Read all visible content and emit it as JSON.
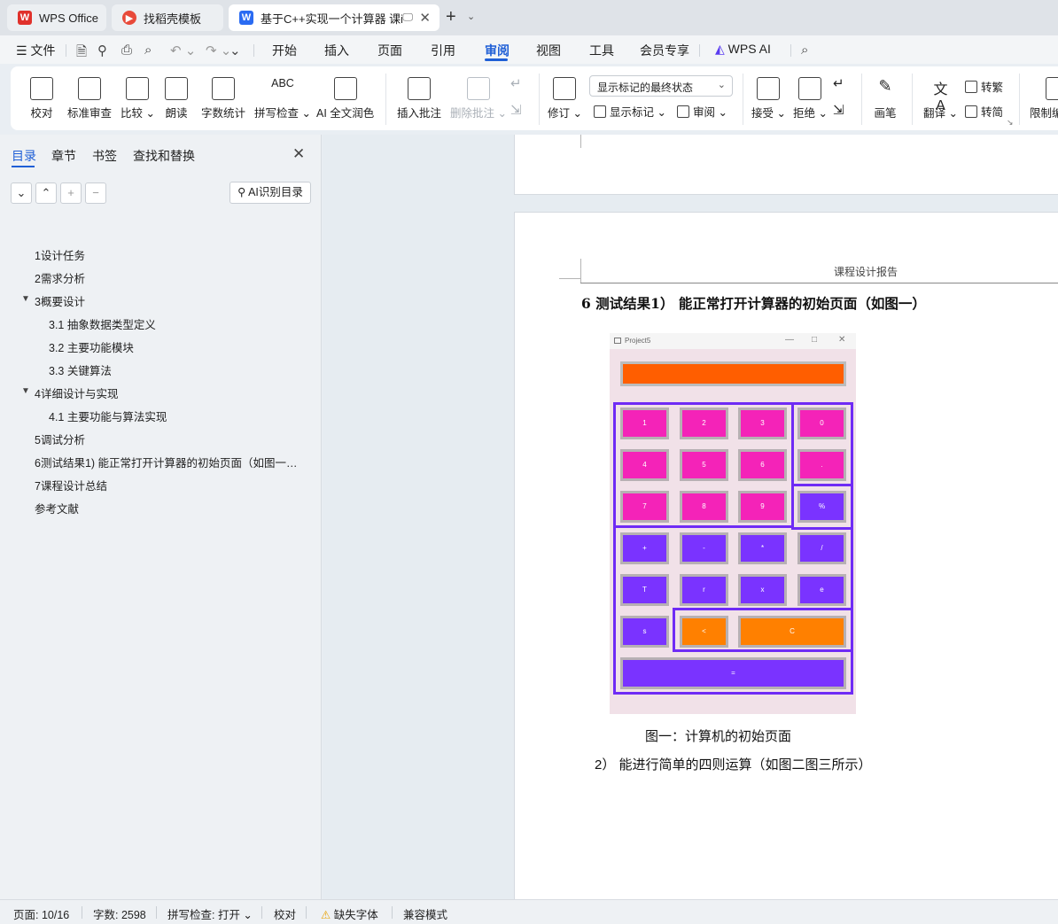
{
  "tabs": [
    {
      "label": "WPS Office",
      "logo": "W"
    },
    {
      "label": "找稻壳模板"
    },
    {
      "label": "基于C++实现一个计算器 课i",
      "logo": "W"
    }
  ],
  "menu": {
    "file": "文件",
    "items": [
      "开始",
      "插入",
      "页面",
      "引用",
      "审阅",
      "视图",
      "工具",
      "会员专享"
    ],
    "active": "审阅",
    "wps_ai": "WPS AI"
  },
  "ribbon": {
    "proofread": "校对",
    "std_review": "标准审查",
    "compare": "比较",
    "read_aloud": "朗读",
    "word_count": "字数统计",
    "spell_check": "拼写检查",
    "ai_polish": "AI 全文润色",
    "insert_comment": "插入批注",
    "delete_comment": "删除批注",
    "revise": "修订",
    "markup_state": "显示标记的最终状态",
    "show_markup": "显示标记",
    "review_pane": "审阅",
    "accept": "接受",
    "reject": "拒绝",
    "pen": "画笔",
    "translate": "翻译",
    "to_traditional": "转繁",
    "to_simplified": "转简",
    "restrict": "限制编"
  },
  "panel": {
    "tabs": [
      "目录",
      "章节",
      "书签",
      "查找和替换"
    ],
    "ai_toc": "AI识别目录",
    "toc": [
      {
        "text": "1设计任务",
        "level": 1
      },
      {
        "text": "2需求分析",
        "level": 1
      },
      {
        "text": "3概要设计",
        "level": 1,
        "expanded": true
      },
      {
        "text": "3.1 抽象数据类型定义",
        "level": 2
      },
      {
        "text": "3.2  主要功能模块",
        "level": 2
      },
      {
        "text": "3.3  关键算法",
        "level": 2
      },
      {
        "text": "4详细设计与实现",
        "level": 1,
        "expanded": true
      },
      {
        "text": "4.1  主要功能与算法实现",
        "level": 2
      },
      {
        "text": "5调试分析",
        "level": 1
      },
      {
        "text": "6测试结果1)   能正常打开计算器的初始页面（如图一…",
        "level": 1
      },
      {
        "text": "7课程设计总结",
        "level": 1
      },
      {
        "text": "参考文献",
        "level": 1
      }
    ]
  },
  "document": {
    "header": "课程设计报告",
    "heading": "6   测试结果1）  能正常打开计算器的初始页面（如图一）",
    "figure_caption": "图一：计算机的初始页面",
    "paragraph": "2）  能进行简单的四则运算（如图二图三所示）",
    "calculator": {
      "window_title": "Project5",
      "keys": [
        {
          "label": "1",
          "color": "pink"
        },
        {
          "label": "2",
          "color": "pink"
        },
        {
          "label": "3",
          "color": "pink"
        },
        {
          "label": "0",
          "color": "pink"
        },
        {
          "label": "4",
          "color": "pink"
        },
        {
          "label": "5",
          "color": "pink"
        },
        {
          "label": "6",
          "color": "pink"
        },
        {
          "label": ".",
          "color": "pink"
        },
        {
          "label": "7",
          "color": "pink"
        },
        {
          "label": "8",
          "color": "pink"
        },
        {
          "label": "9",
          "color": "pink"
        },
        {
          "label": "%",
          "color": "purple"
        },
        {
          "label": "+",
          "color": "purple"
        },
        {
          "label": "-",
          "color": "purple"
        },
        {
          "label": "*",
          "color": "purple"
        },
        {
          "label": "/",
          "color": "purple"
        },
        {
          "label": "T",
          "color": "purple"
        },
        {
          "label": "r",
          "color": "purple"
        },
        {
          "label": "x",
          "color": "purple"
        },
        {
          "label": "e",
          "color": "purple"
        },
        {
          "label": "s",
          "color": "purple"
        },
        {
          "label": "<",
          "color": "orange"
        },
        {
          "label": "C",
          "color": "orange"
        },
        {
          "label": "=",
          "color": "purple"
        }
      ],
      "colors": {
        "display": "#ff5e00",
        "pink": "#f423b8",
        "purple": "#7a33ff",
        "orange": "#ff8000",
        "outline": "#6f2bf5"
      }
    }
  },
  "status": {
    "page": "页面: 10/16",
    "words": "字数: 2598",
    "spell": "拼写检查: 打开",
    "proofread": "校对",
    "missing_font": "缺失字体",
    "compat": "兼容模式"
  }
}
